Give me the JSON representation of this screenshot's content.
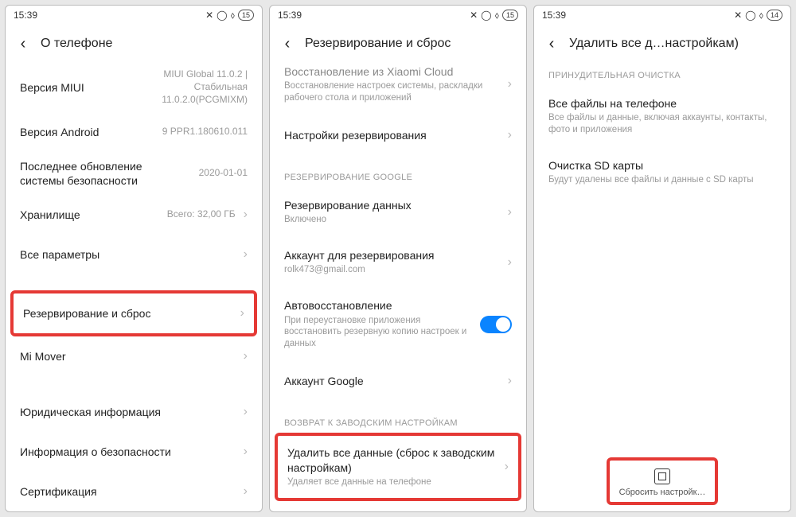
{
  "statusbar": {
    "time": "15:39",
    "battery1": "15",
    "battery3": "14"
  },
  "p1": {
    "title": "О телефоне",
    "rows": [
      {
        "label": "Версия MIUI",
        "value": "MIUI Global 11.0.2 |\nСтабильная\n11.0.2.0(PCGMIXM)"
      },
      {
        "label": "Версия Android",
        "value": "9 PPR1.180610.011"
      },
      {
        "label": "Последнее обновление\nсистемы безопасности",
        "value": "2020-01-01"
      },
      {
        "label": "Хранилище",
        "value": "Всего: 32,00 ГБ",
        "chev": true
      },
      {
        "label": "Все параметры",
        "chev": true
      }
    ],
    "hl": {
      "label": "Резервирование и сброс"
    },
    "rows2": [
      {
        "label": "Mi Mover",
        "chev": true
      }
    ],
    "rows3": [
      {
        "label": "Юридическая информация",
        "chev": true
      },
      {
        "label": "Информация о безопасности",
        "chev": true
      },
      {
        "label": "Сертификация",
        "chev": true
      }
    ]
  },
  "p2": {
    "title": "Резервирование и сброс",
    "top": [
      {
        "label": "Восстановление из Xiaomi Cloud",
        "sub": "Восстановление настроек системы, раскладки рабочего стола и приложений",
        "chev": true
      },
      {
        "label": "Настройки резервирования",
        "chev": true
      }
    ],
    "sect1": "РЕЗЕРВИРОВАНИЕ GOOGLE",
    "g": [
      {
        "label": "Резервирование данных",
        "sub": "Включено",
        "chev": true
      },
      {
        "label": "Аккаунт для резервирования",
        "sub": "rolk473@gmail.com",
        "chev": true
      },
      {
        "label": "Автовосстановление",
        "sub": "При переустановке приложения восстановить резервную копию настроек и данных",
        "toggle": true
      },
      {
        "label": "Аккаунт Google",
        "chev": true
      }
    ],
    "sect2": "ВОЗВРАТ К ЗАВОДСКИМ НАСТРОЙКАМ",
    "hl": {
      "label": "Удалить все данные (сброс к заводским настройкам)",
      "sub": "Удаляет все данные на телефоне"
    }
  },
  "p3": {
    "title": "Удалить все д…настройкам)",
    "sect": "ПРИНУДИТЕЛЬНАЯ ОЧИСТКА",
    "rows": [
      {
        "label": "Все файлы на телефоне",
        "sub": "Все файлы и данные, включая аккаунты, контакты, фото и приложения"
      },
      {
        "label": "Очистка SD карты",
        "sub": "Будут удалены все файлы и данные с SD карты"
      }
    ],
    "btn": "Сбросить настройк…"
  }
}
